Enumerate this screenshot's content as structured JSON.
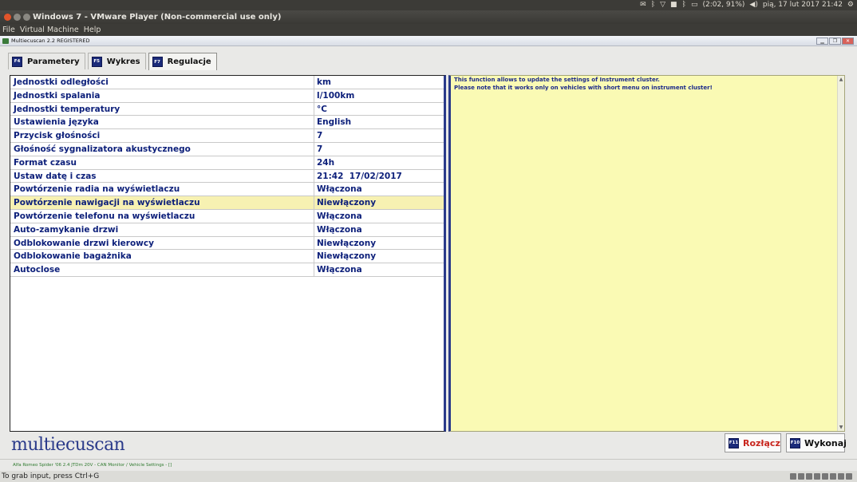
{
  "os_panel": {
    "battery": "(2:02, 91%)",
    "datetime": "pią, 17 lut 2017 21:42"
  },
  "vm_window": {
    "title": "Windows 7 - VMware Player (Non-commercial use only)",
    "menu": [
      "File",
      "Virtual Machine",
      "Help"
    ],
    "status": "To grab input, press Ctrl+G"
  },
  "app": {
    "title": "Multiecuscan 2.2 REGISTERED",
    "logo": "multiecuscan",
    "tabs": [
      {
        "key": "F4",
        "label": "Parametery"
      },
      {
        "key": "F5",
        "label": "Wykres"
      },
      {
        "key": "F7",
        "label": "Regulacje"
      }
    ],
    "active_tab": "Regulacje",
    "rows": [
      {
        "name": "Jednostki odległości",
        "value": "km"
      },
      {
        "name": "Jednostki spalania",
        "value": "l/100km"
      },
      {
        "name": "Jednostki temperatury",
        "value": "°C"
      },
      {
        "name": "Ustawienia języka",
        "value": "English"
      },
      {
        "name": "Przycisk głośności",
        "value": "7"
      },
      {
        "name": "Głośność sygnalizatora akustycznego",
        "value": "7"
      },
      {
        "name": "Format czasu",
        "value": "24h"
      },
      {
        "name": "Ustaw datę i czas",
        "value": "21:42  17/02/2017"
      },
      {
        "name": "Powtórzenie radia na wyświetlaczu",
        "value": "Włączona"
      },
      {
        "name": "Powtórzenie nawigacji na wyświetlaczu",
        "value": "Niewłączony"
      },
      {
        "name": "Powtórzenie telefonu na wyświetlaczu",
        "value": "Włączona"
      },
      {
        "name": "Auto-zamykanie drzwi",
        "value": "Włączona"
      },
      {
        "name": "Odblokowanie drzwi kierowcy",
        "value": "Niewłączony"
      },
      {
        "name": "Odblokowanie bagażnika",
        "value": "Niewłączony"
      },
      {
        "name": "Autoclose",
        "value": "Włączona"
      }
    ],
    "selected_row": 9,
    "info": {
      "line1": "This function allows to update the settings of Instrument cluster.",
      "line2": "Please note that it works only on vehicles with short menu on instrument cluster!"
    },
    "buttons": {
      "disconnect": {
        "key": "F11",
        "label": "Rozłącz"
      },
      "execute": {
        "key": "F10",
        "label": "Wykonaj"
      }
    },
    "status": "Alfa Romeo Spider '06 2.4 JTDm 20V - CAN Monitor / Vehicle Settings - []"
  },
  "colors": {
    "accent_navy": "#2a3a8a",
    "text_blue": "#0c1f7a",
    "selected_row": "#f7f1b2",
    "info_bg": "#fafab4",
    "disconnect_red": "#c8251d"
  }
}
